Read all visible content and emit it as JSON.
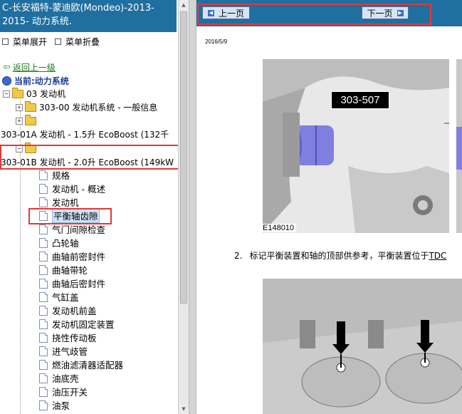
{
  "left_pane": {
    "title": "C-长安福特-蒙迪欧(Mondeo)-2013-2015- 动力系统.",
    "menu": {
      "expand_label": "菜单展开",
      "collapse_label": "菜单折叠"
    },
    "back_link": "返回上一级",
    "current": "当前:动力系统",
    "tree": {
      "engine_folder": "03 发动机",
      "general_info": "303-00 发动机系统 - 一般信息",
      "ecoboost_15": "303-01A 发动机 - 1.5升 EcoBoost (132千",
      "ecoboost_20": "303-01B 发动机 - 2.0升 EcoBoost (149kW",
      "leaves": [
        "规格",
        "发动机 - 概述",
        "发动机",
        "平衡轴齿隙",
        "气门间隙检查",
        "凸轮轴",
        "曲轴前密封件",
        "曲轴带轮",
        "曲轴后密封件",
        "气缸盖",
        "发动机前盖",
        "发动机固定装置",
        "挠性传动板",
        "进气歧管",
        "燃油滤清器适配器",
        "油底壳",
        "油压开关",
        "油泵"
      ],
      "selected_leaf": "平衡轴齿隙"
    }
  },
  "right_pane": {
    "nav": {
      "prev_label": "上一页",
      "next_label": "下一页"
    },
    "date": "2016/5/9",
    "figure1": {
      "callout": "303-507",
      "id": "E148010"
    },
    "step": {
      "number": "2.",
      "text": "标记平衡装置和轴的顶部供参考，平衡装置位于",
      "link": "TDC"
    }
  },
  "colors": {
    "title_bar": "#1f6fa0",
    "highlight_box": "#e23a3a",
    "link_green": "#1a7a1a",
    "current_blue": "#1a3c9c"
  }
}
